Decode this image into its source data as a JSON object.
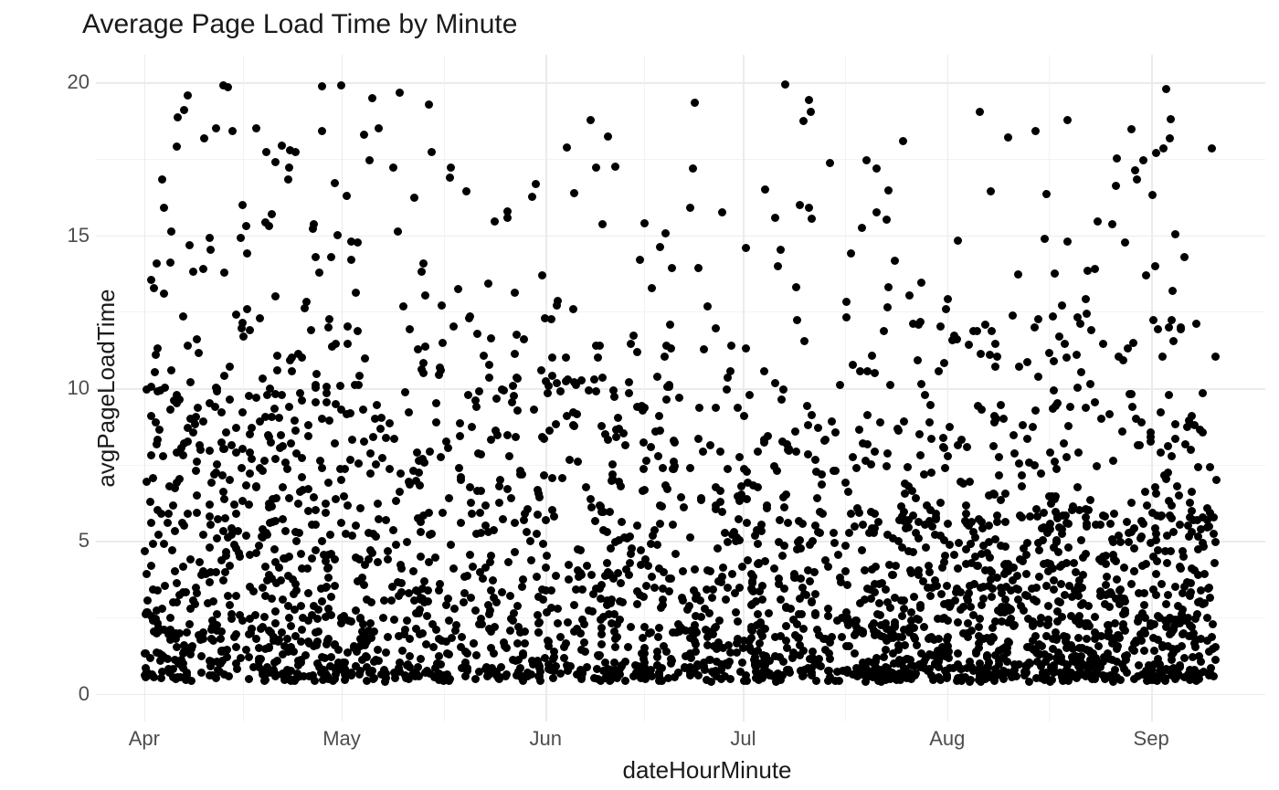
{
  "chart_data": {
    "type": "scatter",
    "title": "Average Page Load Time by Minute",
    "xlabel": "dateHourMinute",
    "ylabel": "avgPageLoadTime",
    "x_ticks": [
      "Apr",
      "May",
      "Jun",
      "Jul",
      "Aug",
      "Sep"
    ],
    "y_ticks": [
      0,
      5,
      10,
      15,
      20
    ],
    "ylim": [
      0,
      20
    ],
    "x_range_days": [
      0,
      163
    ],
    "note": "Dense scatter of ~3000 points; most values cluster 0.5–10 with sparse points up to 20. Positions below are approximate [dayIndex, value] pairs sampled from the image.",
    "points_seed": [
      [
        1,
        4.2
      ],
      [
        1,
        5.6
      ],
      [
        1,
        7.8
      ],
      [
        1,
        9.1
      ],
      [
        2,
        2.3
      ],
      [
        2,
        3.4
      ],
      [
        2,
        6.0
      ],
      [
        2,
        8.3
      ],
      [
        2,
        11.3
      ],
      [
        3,
        1.2
      ],
      [
        3,
        4.9
      ],
      [
        3,
        13.1
      ],
      [
        3,
        15.9
      ],
      [
        4,
        2.1
      ],
      [
        4,
        9.3
      ],
      [
        4,
        14.1
      ],
      [
        5,
        3.0
      ],
      [
        5,
        6.9
      ],
      [
        5,
        7.9
      ],
      [
        5,
        17.9
      ],
      [
        6,
        1.6
      ],
      [
        6,
        5.5
      ],
      [
        6,
        8.2
      ],
      [
        6,
        19.1
      ],
      [
        7,
        2.8
      ],
      [
        7,
        4.4
      ],
      [
        7,
        9.0
      ],
      [
        7,
        10.2
      ],
      [
        8,
        3.3
      ],
      [
        8,
        6.5
      ],
      [
        8,
        7.6
      ],
      [
        8,
        11.6
      ],
      [
        9,
        2.0
      ],
      [
        9,
        4.0
      ],
      [
        9,
        5.2
      ],
      [
        9,
        8.9
      ],
      [
        9,
        13.9
      ],
      [
        10,
        1.1
      ],
      [
        10,
        4.8
      ],
      [
        10,
        6.2
      ],
      [
        10,
        9.5
      ],
      [
        10,
        14.9
      ],
      [
        11,
        2.6
      ],
      [
        11,
        5.1
      ],
      [
        11,
        7.5
      ],
      [
        11,
        9.9
      ],
      [
        12,
        1.4
      ],
      [
        12,
        3.7
      ],
      [
        12,
        6.6
      ],
      [
        12,
        8.0
      ],
      [
        12,
        19.9
      ],
      [
        13,
        2.9
      ],
      [
        13,
        4.2
      ],
      [
        13,
        7.0
      ],
      [
        13,
        10.7
      ],
      [
        14,
        1.0
      ],
      [
        14,
        3.2
      ],
      [
        14,
        5.9
      ],
      [
        14,
        8.7
      ],
      [
        14,
        12.4
      ],
      [
        15,
        2.4
      ],
      [
        15,
        6.3
      ],
      [
        15,
        9.2
      ],
      [
        15,
        16.0
      ],
      [
        16,
        3.5
      ],
      [
        16,
        7.2
      ],
      [
        16,
        8.5
      ],
      [
        16,
        11.9
      ],
      [
        17,
        1.8
      ],
      [
        17,
        4.6
      ],
      [
        17,
        6.8
      ],
      [
        17,
        9.7
      ],
      [
        17,
        18.5
      ],
      [
        18,
        2.2
      ],
      [
        18,
        5.4
      ],
      [
        18,
        7.3
      ],
      [
        18,
        10.3
      ],
      [
        19,
        1.5
      ],
      [
        19,
        3.9
      ],
      [
        19,
        6.1
      ],
      [
        19,
        8.4
      ],
      [
        19,
        15.3
      ],
      [
        20,
        2.7
      ],
      [
        20,
        4.3
      ],
      [
        20,
        7.7
      ],
      [
        20,
        9.8
      ],
      [
        20,
        13.0
      ],
      [
        21,
        1.3
      ],
      [
        21,
        3.1
      ],
      [
        21,
        5.7
      ],
      [
        21,
        8.1
      ],
      [
        22,
        2.5
      ],
      [
        22,
        4.5
      ],
      [
        22,
        6.4
      ],
      [
        22,
        9.4
      ],
      [
        22,
        17.2
      ],
      [
        23,
        1.9
      ],
      [
        23,
        3.6
      ],
      [
        23,
        5.3
      ],
      [
        23,
        8.6
      ],
      [
        24,
        2.1
      ],
      [
        24,
        4.1
      ],
      [
        24,
        7.1
      ],
      [
        24,
        9.6
      ],
      [
        24,
        11.0
      ],
      [
        25,
        1.7
      ],
      [
        25,
        3.3
      ],
      [
        25,
        6.7
      ],
      [
        25,
        8.8
      ],
      [
        26,
        2.0
      ],
      [
        26,
        4.7
      ],
      [
        26,
        6.0
      ],
      [
        26,
        10.1
      ],
      [
        26,
        14.3
      ],
      [
        27,
        1.2
      ],
      [
        27,
        5.0
      ],
      [
        27,
        7.4
      ],
      [
        27,
        9.0
      ],
      [
        28,
        2.8
      ],
      [
        28,
        3.8
      ],
      [
        28,
        6.9
      ],
      [
        28,
        12.0
      ],
      [
        29,
        1.6
      ],
      [
        29,
        4.4
      ],
      [
        29,
        8.2
      ],
      [
        29,
        16.7
      ],
      [
        30,
        2.3
      ],
      [
        30,
        5.6
      ],
      [
        30,
        7.0
      ],
      [
        30,
        9.3
      ],
      [
        30,
        19.9
      ]
    ],
    "density_profile": [
      {
        "days": [
          0,
          40
        ],
        "low": 0.5,
        "high": 10.0,
        "weight": 1.0
      },
      {
        "days": [
          0,
          40
        ],
        "low": 10.0,
        "high": 20.0,
        "weight": 0.15
      },
      {
        "days": [
          40,
          80
        ],
        "low": 0.5,
        "high": 10.0,
        "weight": 1.0
      },
      {
        "days": [
          40,
          80
        ],
        "low": 10.0,
        "high": 20.0,
        "weight": 0.16
      },
      {
        "days": [
          80,
          110
        ],
        "low": 0.5,
        "high": 8.0,
        "weight": 1.0
      },
      {
        "days": [
          80,
          110
        ],
        "low": 8.0,
        "high": 20.0,
        "weight": 0.18
      },
      {
        "days": [
          110,
          163
        ],
        "low": 0.5,
        "high": 5.5,
        "weight": 1.2
      },
      {
        "days": [
          110,
          163
        ],
        "low": 5.5,
        "high": 12.0,
        "weight": 0.35
      },
      {
        "days": [
          110,
          163
        ],
        "low": 12.0,
        "high": 20.0,
        "weight": 0.09
      }
    ],
    "colors": {
      "point": "#000000",
      "grid": "#ebebeb",
      "grid_minor": "#f3f3f3"
    }
  }
}
